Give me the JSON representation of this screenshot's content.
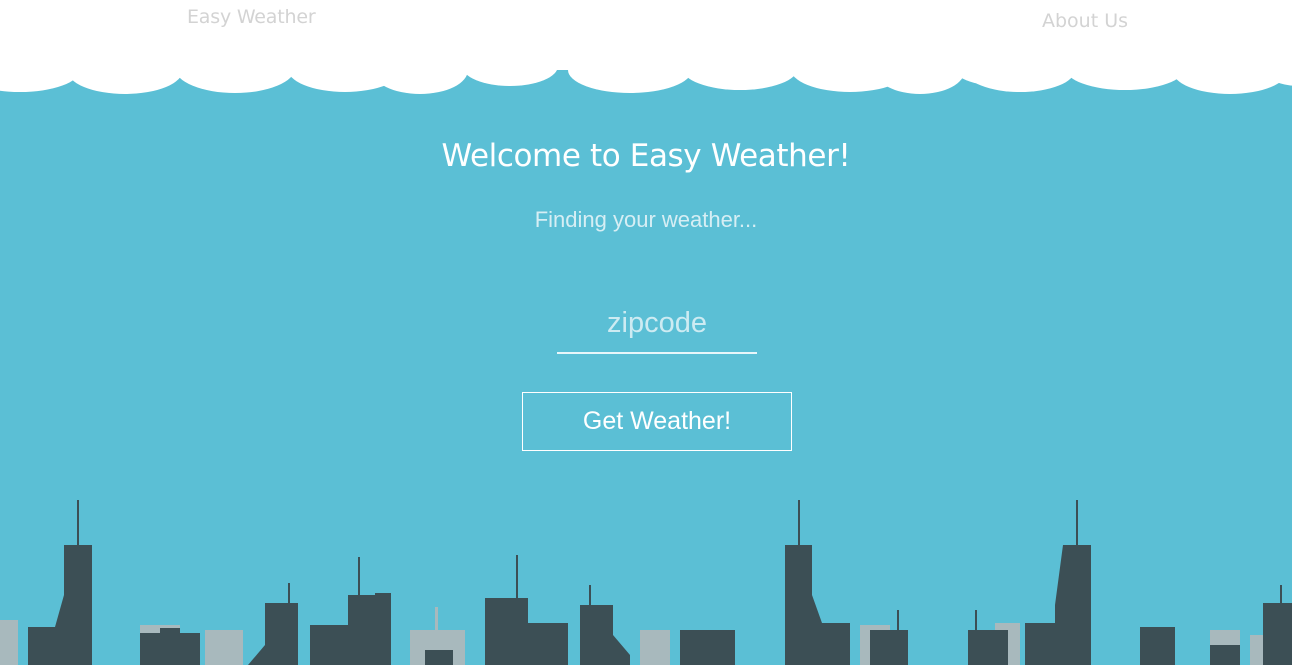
{
  "nav": {
    "brand": "Easy Weather",
    "about": "About Us"
  },
  "hero": {
    "title": "Welcome to Easy Weather!",
    "status": "Finding your weather..."
  },
  "form": {
    "zip_placeholder": "zipcode",
    "zip_value": "",
    "button_label": "Get Weather!"
  },
  "colors": {
    "sky": "#5bbfd5",
    "cloud": "#ffffff",
    "building_front": "#3c4f55",
    "building_back": "#a8b9bd"
  }
}
